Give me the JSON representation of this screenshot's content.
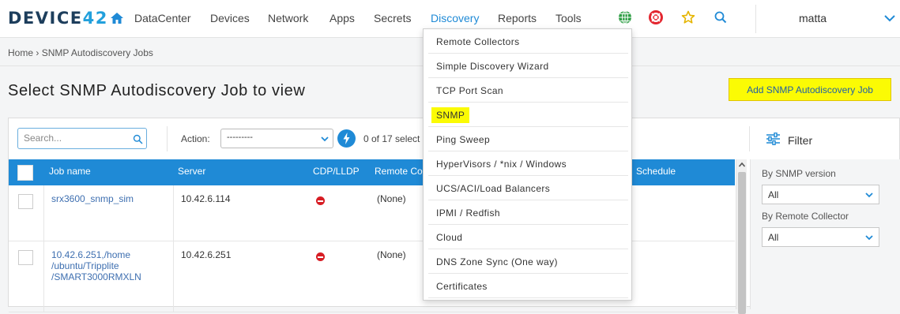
{
  "logo": {
    "text_a": "DEVIC",
    "text_b": "E",
    "text_c": "42"
  },
  "nav": {
    "items": [
      "DataCenter",
      "Devices",
      "Network",
      "Apps",
      "Secrets",
      "Discovery",
      "Reports",
      "Tools"
    ],
    "active": "Discovery",
    "icons": [
      "home-icon",
      "globe-icon",
      "lifebuoy-icon",
      "star-icon",
      "search-icon"
    ],
    "user": "matta"
  },
  "breadcrumb": {
    "home": "Home",
    "sep": "›",
    "current": "SNMP Autodiscovery Jobs"
  },
  "page": {
    "title": "Select SNMP Autodiscovery Job to view",
    "add_button": "Add SNMP Autodiscovery Job"
  },
  "toolbar": {
    "search_placeholder": "Search...",
    "action_label": "Action:",
    "action_value": "---------",
    "count_text": "0 of 17 select"
  },
  "table": {
    "columns": [
      "Job name",
      "Server",
      "CDP/LLDP",
      "Remote Col",
      "Schedule"
    ],
    "rows": [
      {
        "job_name": "srx3600_snmp_sim",
        "server": "10.42.6.114",
        "remote": "(None)"
      },
      {
        "job_name_lines": [
          "10.42.6.251,/home",
          "/ubuntu/Tripplite",
          "/SMART3000RMXLN"
        ],
        "server": "10.42.6.251",
        "remote": "(None)"
      }
    ]
  },
  "filter": {
    "title": "Filter",
    "fields": [
      {
        "label": "By SNMP version",
        "value": "All"
      },
      {
        "label": "By Remote Collector",
        "value": "All"
      }
    ]
  },
  "discovery_menu": {
    "items": [
      "Remote Collectors",
      "Simple Discovery Wizard",
      "TCP Port Scan",
      "SNMP",
      "Ping Sweep",
      "HyperVisors / *nix / Windows",
      "UCS/ACI/Load Balancers",
      "IPMI / Redfish",
      "Cloud",
      "DNS Zone Sync (One way)",
      "Certificates"
    ],
    "highlighted": "SNMP"
  },
  "colors": {
    "brand": "#1d3e5c",
    "accent": "#1f8ad6",
    "highlight": "#fbfb04",
    "danger": "#d71d24"
  }
}
